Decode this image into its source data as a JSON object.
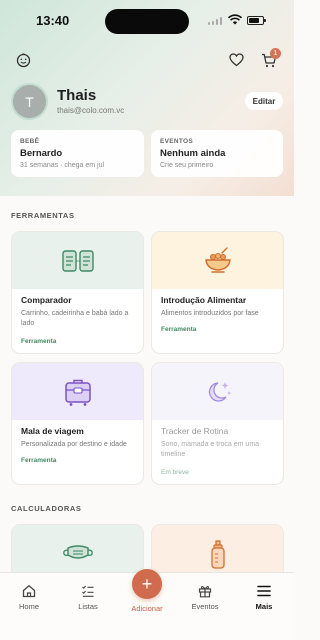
{
  "status_bar": {
    "time": "13:40"
  },
  "header": {
    "cart_count": "1"
  },
  "profile": {
    "avatar_initial": "T",
    "name": "Thais",
    "email": "thais@colo.com.vc",
    "edit_label": "Editar"
  },
  "cards": {
    "baby": {
      "kicker": "BEBÊ",
      "title": "Bernardo",
      "subtitle": "31 semanas · chega em jul"
    },
    "events": {
      "kicker": "EVENTOS",
      "title": "Nenhum ainda",
      "subtitle": "Crie seu primeiro"
    }
  },
  "sections": {
    "tools": "FERRAMENTAS",
    "calculators": "CALCULADORAS"
  },
  "tools": [
    {
      "title": "Comparador",
      "description": "Carrinho, cadeirinha e babá lado a lado",
      "tag": "Ferramenta",
      "icon": "stroller-compare-icon"
    },
    {
      "title": "Introdução Alimentar",
      "description": "Alimentos introduzidos por fase",
      "tag": "Ferramenta",
      "icon": "food-bowl-icon"
    },
    {
      "title": "Mala de viagem",
      "description": "Personalizada por destino e idade",
      "tag": "Ferramenta",
      "icon": "suitcase-icon"
    },
    {
      "title": "Tracker de Rotina",
      "description": "Sono, mamada e troca em uma timeline",
      "tag": "Em breve",
      "icon": "moon-stars-icon"
    }
  ],
  "calculators": [
    {
      "icon": "mask-icon"
    },
    {
      "icon": "baby-bottle-icon"
    }
  ],
  "tabbar": {
    "home": "Home",
    "lists": "Listas",
    "add": "Adicionar",
    "events": "Eventos",
    "more": "Mais"
  },
  "colors": {
    "accent": "#d06b4d",
    "green": "#3f8a63",
    "comparador_bg": "#e8f1ec",
    "alimentar_bg": "#fdf3df",
    "mala_bg": "#eee9fb",
    "tracker_bg": "#f6f4fb"
  }
}
